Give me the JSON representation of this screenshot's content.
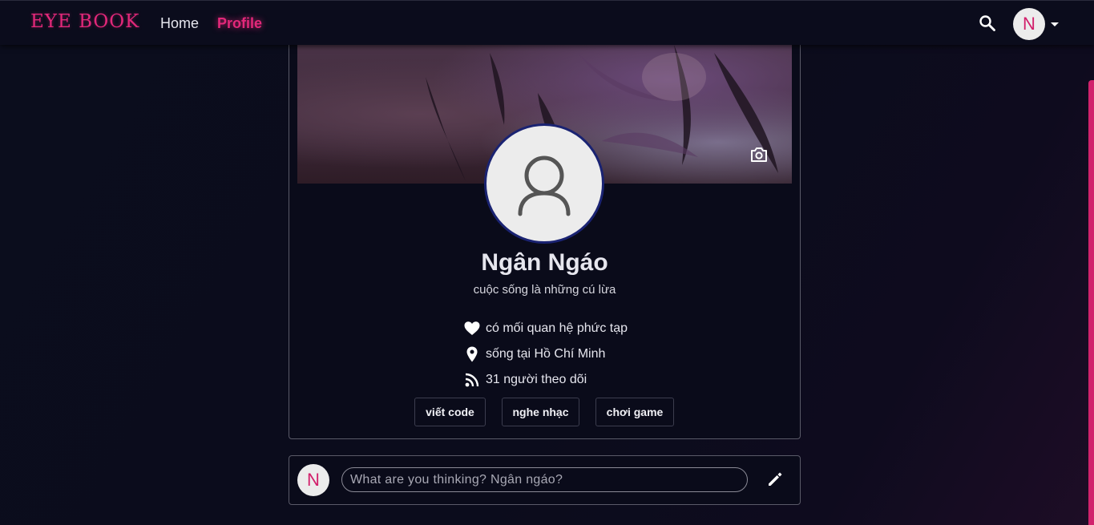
{
  "nav": {
    "logo": "EYE BOOK",
    "home": "Home",
    "profile": "Profile",
    "avatar_letter": "N",
    "search_icon": "search-icon",
    "caret_icon": "caret-down-icon"
  },
  "profile": {
    "name": "Ngân Ngáo",
    "bio": "cuộc sống là những cú lừa",
    "cover_icon": "camera-icon",
    "avatar_icon": "person-icon",
    "info": [
      {
        "icon": "heart-icon",
        "text": "có mối quan hệ phức tạp"
      },
      {
        "icon": "location-pin-icon",
        "text": "sống tại Hồ Chí Minh"
      },
      {
        "icon": "rss-feed-icon",
        "text": "31 người theo dõi"
      }
    ],
    "hobbies": [
      "viết code",
      "nghe nhạc",
      "chơi game"
    ]
  },
  "post": {
    "avatar_letter": "N",
    "placeholder": "What are you thinking? Ngân ngáo?",
    "edit_icon": "pencil-icon"
  },
  "colors": {
    "accent": "#e3287a",
    "background": "#0b0c1c",
    "avatar_bg": "#ececec",
    "avatar_border": "#1a2372"
  }
}
